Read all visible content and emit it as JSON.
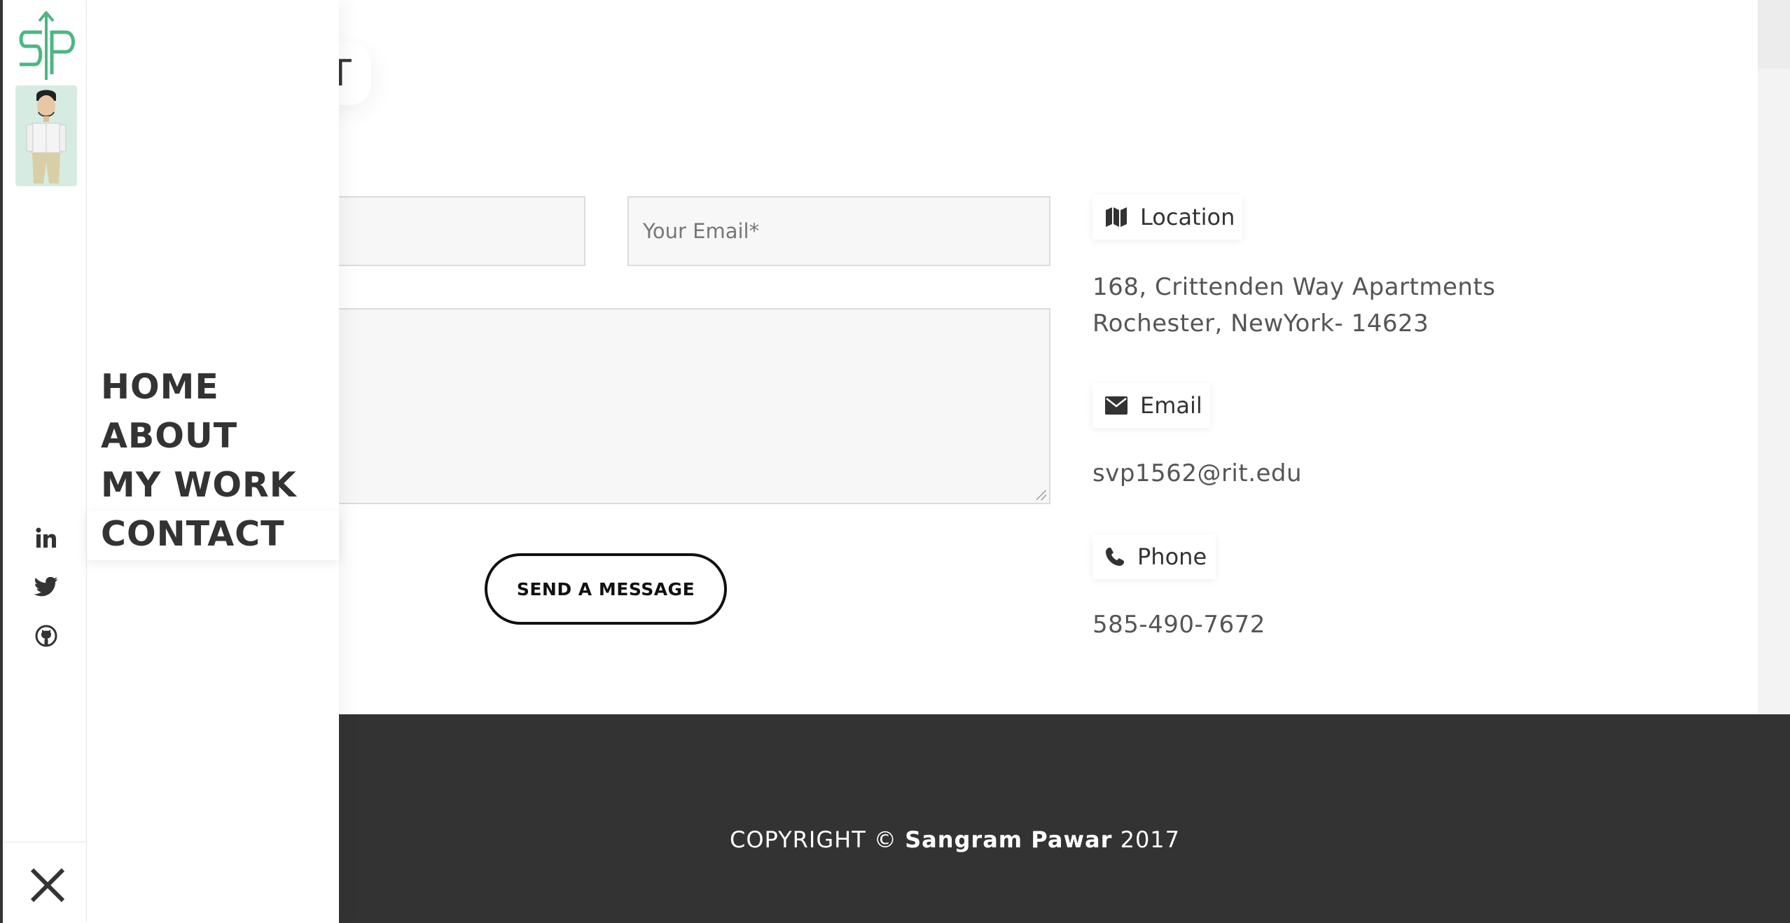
{
  "section": {
    "title_fragment": "T"
  },
  "form": {
    "name_placeholder": "",
    "email_placeholder": "Your Email*",
    "message_placeholder": "",
    "send_label": "SEND A MESSAGE"
  },
  "contact_info": {
    "location_label": "Location",
    "address_line1": "168, Crittenden Way Apartments",
    "address_line2": "Rochester, NewYork- 14623",
    "email_label": "Email",
    "email_value": "svp1562@rit.edu",
    "phone_label": "Phone",
    "phone_value": "585-490-7672"
  },
  "footer": {
    "copyright_prefix": "COPYRIGHT ©",
    "owner": "Sangram Pawar",
    "year": "2017"
  },
  "sidebar": {
    "logo_text": "SP",
    "menu": [
      {
        "label": "HOME"
      },
      {
        "label": "ABOUT"
      },
      {
        "label": "MY WORK"
      },
      {
        "label": "CONTACT",
        "active": true
      }
    ],
    "social": [
      "linkedin-icon",
      "twitter-icon",
      "github-icon"
    ],
    "close_icon": "close-icon"
  },
  "colors": {
    "footer_bg": "#333333",
    "logo_green": "#4cb782",
    "text_dark": "#333333",
    "text_muted": "#555555"
  }
}
